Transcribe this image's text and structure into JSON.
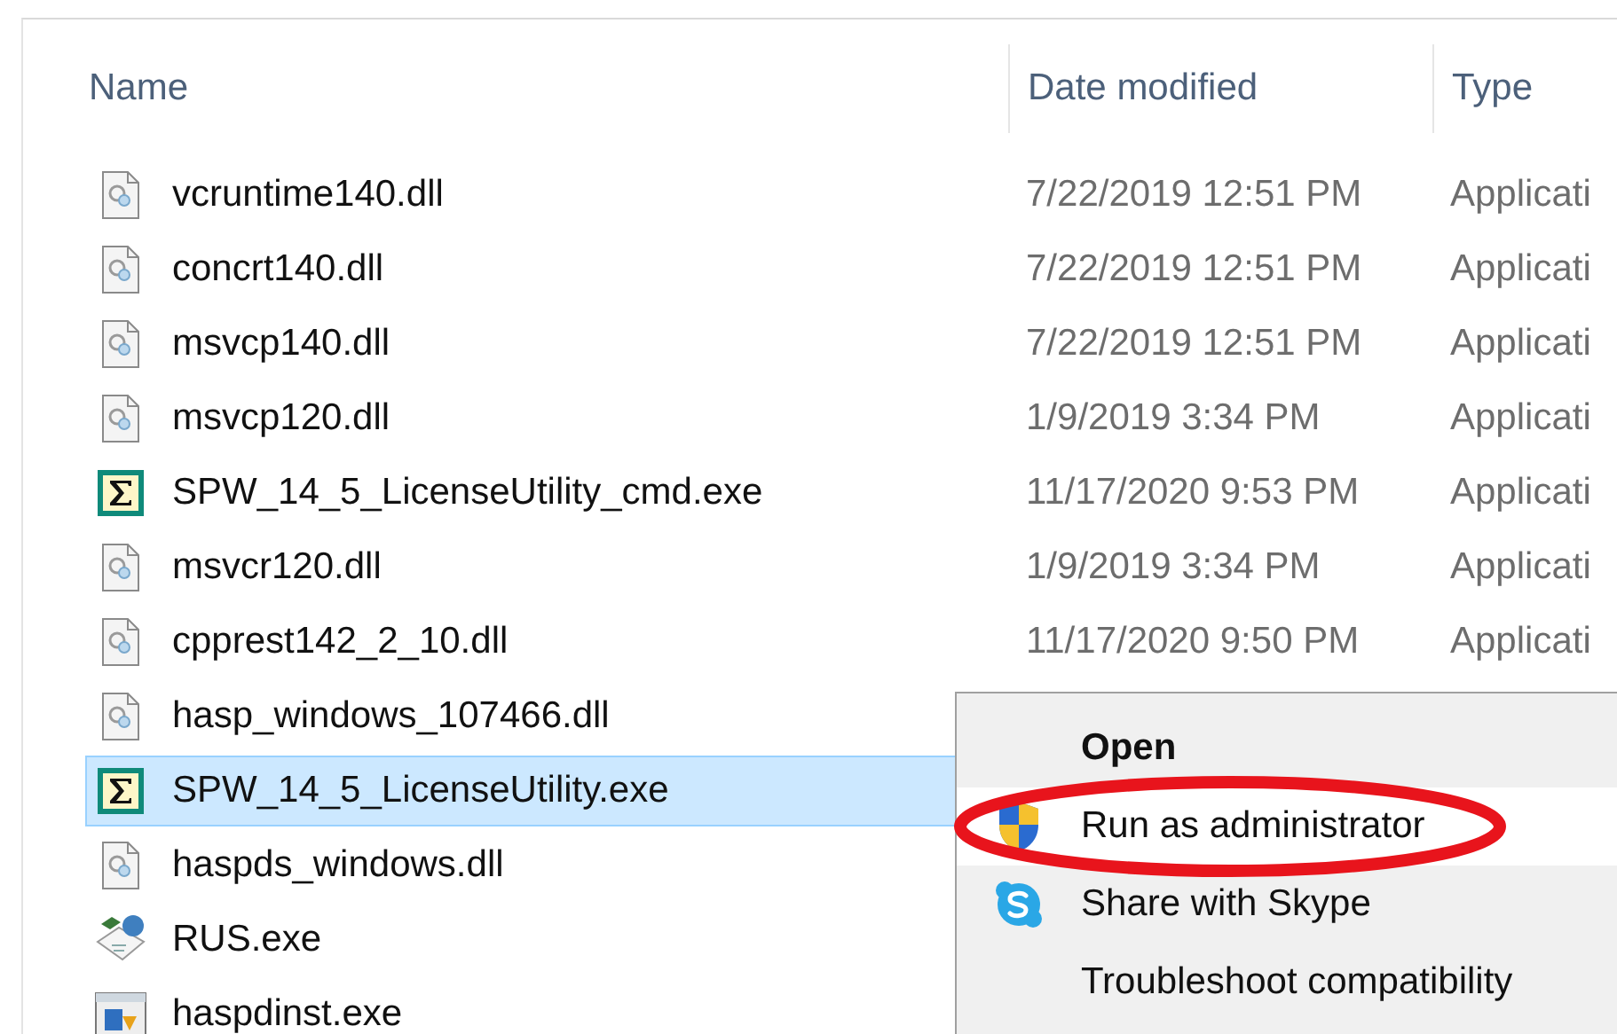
{
  "columns": [
    {
      "label": "Name"
    },
    {
      "label": "Date modified"
    },
    {
      "label": "Type"
    }
  ],
  "files": [
    {
      "name": "vcruntime140.dll",
      "kind": "dll",
      "date": "7/22/2019 12:51 PM",
      "type": "Applicati",
      "selected": false
    },
    {
      "name": "concrt140.dll",
      "kind": "dll",
      "date": "7/22/2019 12:51 PM",
      "type": "Applicati",
      "selected": false
    },
    {
      "name": "msvcp140.dll",
      "kind": "dll",
      "date": "7/22/2019 12:51 PM",
      "type": "Applicati",
      "selected": false
    },
    {
      "name": "msvcp120.dll",
      "kind": "dll",
      "date": "1/9/2019 3:34 PM",
      "type": "Applicati",
      "selected": false
    },
    {
      "name": "SPW_14_5_LicenseUtility_cmd.exe",
      "kind": "sigma",
      "date": "11/17/2020 9:53 PM",
      "type": "Applicati",
      "selected": false
    },
    {
      "name": "msvcr120.dll",
      "kind": "dll",
      "date": "1/9/2019 3:34 PM",
      "type": "Applicati",
      "selected": false
    },
    {
      "name": "cpprest142_2_10.dll",
      "kind": "dll",
      "date": "11/17/2020 9:50 PM",
      "type": "Applicati",
      "selected": false
    },
    {
      "name": "hasp_windows_107466.dll",
      "kind": "dll",
      "selected": false
    },
    {
      "name": "SPW_14_5_LicenseUtility.exe",
      "kind": "sigma",
      "selected": true
    },
    {
      "name": "haspds_windows.dll",
      "kind": "dll",
      "selected": false
    },
    {
      "name": "RUS.exe",
      "kind": "rus",
      "selected": false
    },
    {
      "name": "haspdinst.exe",
      "kind": "installer",
      "selected": false
    }
  ],
  "context_menu": [
    {
      "label": "Open",
      "kind": "default",
      "hovered": false,
      "annotated": false
    },
    {
      "label": "Run as administrator",
      "kind": "shield",
      "hovered": true,
      "annotated": true
    },
    {
      "label": "Share with Skype",
      "kind": "skype",
      "hovered": false,
      "annotated": false
    },
    {
      "label": "Troubleshoot compatibility",
      "kind": "plain",
      "hovered": false,
      "annotated": false
    }
  ]
}
